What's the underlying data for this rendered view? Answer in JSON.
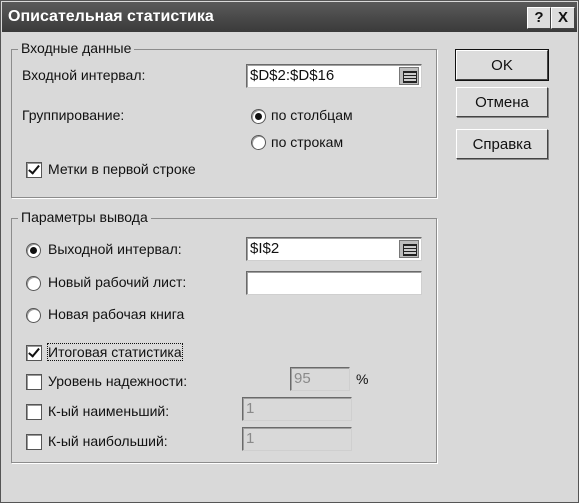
{
  "window": {
    "title": "Описательная статистика",
    "help_button": "?",
    "close_button": "X"
  },
  "input_group": {
    "legend": "Входные данные",
    "range_label": "Входной интервал:",
    "range_value": "$D$2:$D$16",
    "grouping_label": "Группирование:",
    "by_columns": "по столбцам",
    "by_rows": "по строкам",
    "grouping_selected": "по столбцам",
    "labels_first_row": "Метки в первой строке",
    "labels_first_row_checked": true
  },
  "output_group": {
    "legend": "Параметры вывода",
    "output_range_label": "Выходной интервал:",
    "output_range_value": "$I$2",
    "new_sheet_label": "Новый рабочий лист:",
    "new_sheet_value": "",
    "new_book_label": "Новая рабочая книга",
    "selected_output": "Выходной интервал:",
    "summary_stats": "Итоговая статистика",
    "summary_stats_checked": true,
    "confidence_label": "Уровень надежности:",
    "confidence_value": "95",
    "confidence_unit": "%",
    "confidence_checked": false,
    "kth_smallest_label": "К-ый наименьший:",
    "kth_smallest_value": "1",
    "kth_smallest_checked": false,
    "kth_largest_label": "К-ый наибольший:",
    "kth_largest_value": "1",
    "kth_largest_checked": false
  },
  "buttons": {
    "ok": "OK",
    "cancel": "Отмена",
    "help": "Справка"
  }
}
